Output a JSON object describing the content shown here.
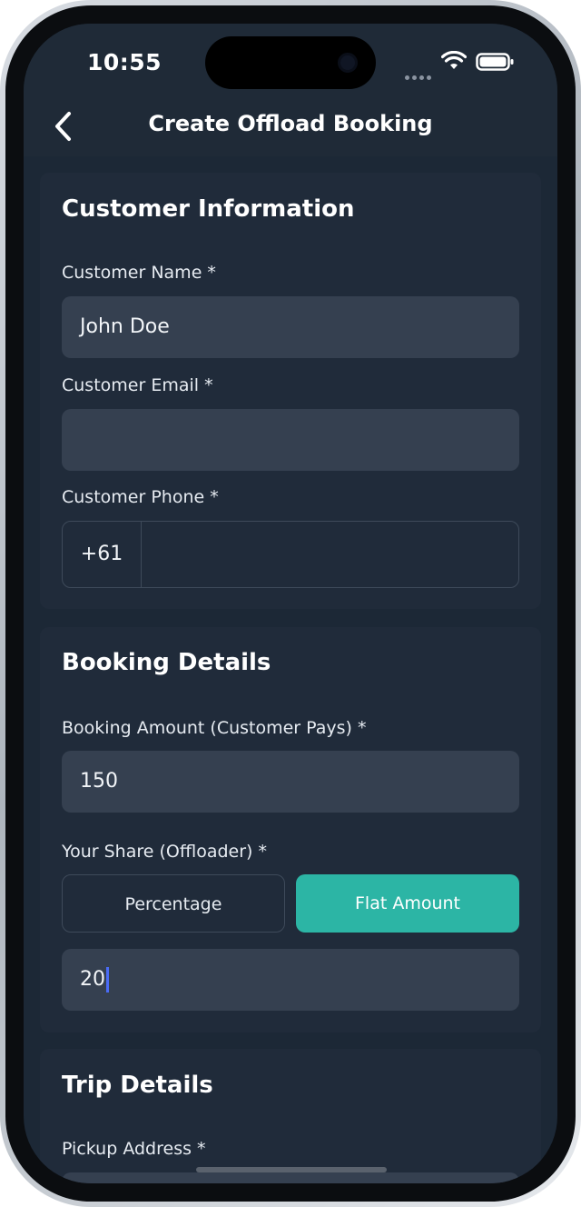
{
  "status_bar": {
    "time": "10:55"
  },
  "header": {
    "title": "Create Offload Booking"
  },
  "customer_info": {
    "title": "Customer Information",
    "name_label": "Customer Name *",
    "name_value": "John Doe",
    "email_label": "Customer Email *",
    "email_value": "",
    "phone_label": "Customer Phone *",
    "phone_code": "+61",
    "phone_value": ""
  },
  "booking_details": {
    "title": "Booking Details",
    "amount_label": "Booking Amount (Customer Pays) *",
    "amount_value": "150",
    "share_label": "Your Share (Offloader) *",
    "share_options": [
      "Percentage",
      "Flat Amount"
    ],
    "share_selected": "Flat Amount",
    "share_value": "20"
  },
  "trip_details": {
    "title": "Trip Details",
    "pickup_label": "Pickup Address *"
  },
  "colors": {
    "background": "#1c2836",
    "card": "#202b3a",
    "input": "#354050",
    "accent": "#2cb5a5"
  },
  "icons": [
    "back-chevron-icon",
    "wifi-icon",
    "battery-icon"
  ]
}
